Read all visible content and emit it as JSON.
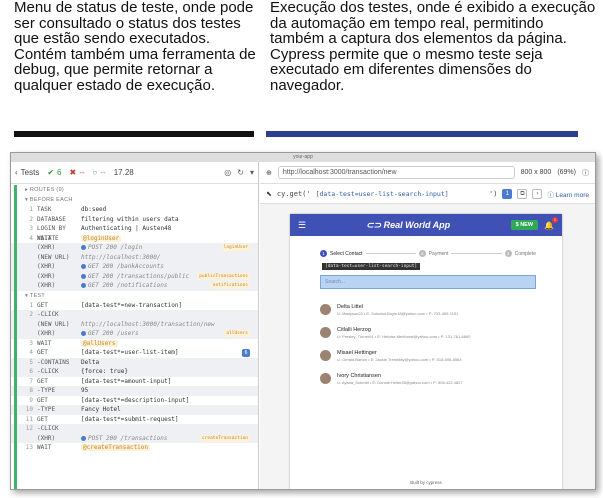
{
  "captions": {
    "left": "Menu de status de teste, onde pode ser consultado o status dos testes que estão sendo executados. Contém também uma ferramenta de debug, que permite retornar a qualquer estado de execução.",
    "right": "Execução dos testes, onde é exibido a execução da automação em tempo real, permitindo também a captura dos elementos da página. Cypress permite que o mesmo teste seja executado em diferentes dimensões do navegador."
  },
  "colors": {
    "left_bar": "#111111",
    "right_bar": "#2b3f8e",
    "pass": "#2b9a3a",
    "app_primary": "#3f51b5"
  },
  "window": {
    "title": "your-app"
  },
  "runner_toolbar": {
    "back": "Tests",
    "passed": "6",
    "failed": "--",
    "pending": "--",
    "duration": "17.28",
    "icons": [
      "chevron-left-icon",
      "check-icon",
      "x-icon",
      "circle-icon",
      "target-icon",
      "refresh-icon",
      "stop-icon"
    ]
  },
  "command_log": {
    "routes_header": "ROUTES (9)",
    "before_each": "BEFORE EACH",
    "test_header": "TEST",
    "before_rows": [
      {
        "num": "1",
        "cmd": "TASK",
        "msg": "db:seed",
        "kind": "cmd"
      },
      {
        "num": "2",
        "cmd": "DATABASE",
        "msg": "filtering within users data",
        "kind": "cmd"
      },
      {
        "num": "3",
        "cmd": "LOGIN BY XSTATE",
        "msg": "Authenticating | Austen48",
        "kind": "cmd"
      },
      {
        "num": "4",
        "cmd": "WAIT",
        "msg": "@loginUser",
        "kind": "alias"
      },
      {
        "num": "",
        "cmd": "(XHR)",
        "msg": "POST 200 /login",
        "kind": "xhr",
        "tag": "loginUser"
      },
      {
        "num": "",
        "cmd": "(NEW URL)",
        "msg": "http://localhost:3000/",
        "kind": "url"
      },
      {
        "num": "",
        "cmd": "(XHR)",
        "msg": "GET 200 /bankAccounts",
        "kind": "xhr"
      },
      {
        "num": "",
        "cmd": "(XHR)",
        "msg": "GET 200 /transactions/public",
        "kind": "xhr",
        "tag": "publicTransactions"
      },
      {
        "num": "",
        "cmd": "(XHR)",
        "msg": "GET 200 /notifications",
        "kind": "xhr",
        "tag": "notifications"
      }
    ],
    "test_rows": [
      {
        "num": "1",
        "cmd": "GET",
        "msg": "[data-test*=new-transaction]",
        "kind": "cmd"
      },
      {
        "num": "2",
        "cmd": "-CLICK",
        "msg": "",
        "kind": "sub"
      },
      {
        "num": "",
        "cmd": "(NEW URL)",
        "msg": "http://localhost:3000/transaction/new",
        "kind": "url"
      },
      {
        "num": "",
        "cmd": "(XHR)",
        "msg": "GET 200 /users",
        "kind": "xhr",
        "tag": "allUsers"
      },
      {
        "num": "3",
        "cmd": "WAIT",
        "msg": "@allUsers",
        "kind": "alias"
      },
      {
        "num": "4",
        "cmd": "GET",
        "msg": "[data-test*=user-list-item]",
        "kind": "cmd",
        "badge": "6"
      },
      {
        "num": "5",
        "cmd": "-CONTAINS",
        "msg": "Delta",
        "kind": "sub"
      },
      {
        "num": "6",
        "cmd": "-CLICK",
        "msg": "{force: true}",
        "kind": "sub"
      },
      {
        "num": "7",
        "cmd": "GET",
        "msg": "[data-test*=amount-input]",
        "kind": "cmd"
      },
      {
        "num": "8",
        "cmd": "-TYPE",
        "msg": "95",
        "kind": "sub"
      },
      {
        "num": "9",
        "cmd": "GET",
        "msg": "[data-test*=description-input]",
        "kind": "cmd"
      },
      {
        "num": "10",
        "cmd": "-TYPE",
        "msg": "Fancy Hotel",
        "kind": "sub"
      },
      {
        "num": "11",
        "cmd": "GET",
        "msg": "[data-test*=submit-request]",
        "kind": "cmd"
      },
      {
        "num": "12",
        "cmd": "-CLICK",
        "msg": "",
        "kind": "sub"
      },
      {
        "num": "",
        "cmd": "(XHR)",
        "msg": "POST 200 /transactions",
        "kind": "xhr",
        "tag": "createTransaction"
      },
      {
        "num": "13",
        "cmd": "WAIT",
        "msg": "@createTransaction",
        "kind": "alias"
      }
    ]
  },
  "browser": {
    "url": "http://localhost:3000/transaction/new",
    "viewport": "800 x 800",
    "zoom": "(69%)",
    "selector_cmd": "cy.get('",
    "selector_value": "[data-test=user-list-search-input]",
    "selector_close": "')",
    "match_count": "1",
    "learn_more": "Learn more"
  },
  "app": {
    "logo": "Real World App",
    "new_button": "$ NEW",
    "notif_count": "1",
    "steps": [
      "Select Contact",
      "Payment",
      "Complete"
    ],
    "step_numbers": [
      "1",
      "2",
      "3"
    ],
    "tooltip": "[data-test=user-list-search-input]",
    "search_placeholder": "Search...",
    "users": [
      {
        "name": "Delta Littel",
        "details": "U: Madyson22 • E: Soledad.Boyle18@yahoo.com • P: 733-459-1151"
      },
      {
        "name": "Citlalli Herzog",
        "details": "U: Presley_Turner91 • E: Heloise.Medhurst@yahoo.com • P: 131-761-6860"
      },
      {
        "name": "Misael Hettinger",
        "details": "U: Gerald.Barton • E: Jackie.Tremblay@yahoo.com • P: 515-596-8564"
      },
      {
        "name": "Ivory Christiansen",
        "details": "U: Ayana_Schmitt • E: Donnie.Heller55@yahoo.com • P: 508.422.4827"
      }
    ],
    "built_by": "Built by cypress"
  }
}
